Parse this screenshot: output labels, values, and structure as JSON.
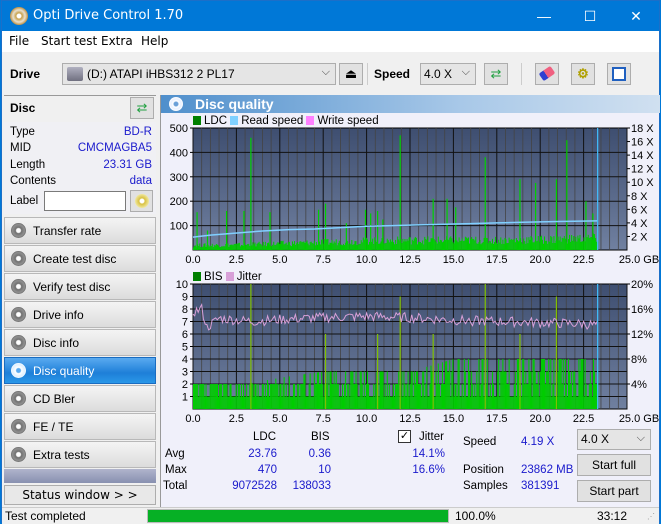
{
  "window": {
    "title": "Opti Drive Control 1.70",
    "minimize": "—",
    "maximize": "☐",
    "close": "✕"
  },
  "menu": [
    "File",
    "Start test",
    "Extra",
    "Help"
  ],
  "toolbar": {
    "drive_label": "Drive",
    "drive_value": "(D:)  ATAPI iHBS312  2 PL17",
    "speed_label": "Speed",
    "speed_value": "4.0 X"
  },
  "disc": {
    "title": "Disc",
    "rows": [
      {
        "key": "Type",
        "value": "BD-R"
      },
      {
        "key": "MID",
        "value": "CMCMAGBA5"
      },
      {
        "key": "Length",
        "value": "23.31 GB"
      },
      {
        "key": "Contents",
        "value": "data"
      }
    ],
    "label_key": "Label",
    "label_value": ""
  },
  "nav": [
    {
      "label": "Transfer rate",
      "active": false
    },
    {
      "label": "Create test disc",
      "active": false
    },
    {
      "label": "Verify test disc",
      "active": false
    },
    {
      "label": "Drive info",
      "active": false
    },
    {
      "label": "Disc info",
      "active": false
    },
    {
      "label": "Disc quality",
      "active": true
    },
    {
      "label": "CD Bler",
      "active": false
    },
    {
      "label": "FE / TE",
      "active": false
    },
    {
      "label": "Extra tests",
      "active": false
    }
  ],
  "status_window_label": "Status window > >",
  "panel_title": "Disc quality",
  "colors": {
    "ldc": "#008000",
    "read_speed": "#80d0ff",
    "write_speed": "#ff80ff",
    "bis": "#008000",
    "jitter": "#d8a0d8",
    "bar_fill": "#00cc00",
    "plot_bg_top": "#3e4e70",
    "plot_bg_bottom": "#7080a0"
  },
  "chart_data": [
    {
      "type": "bar",
      "title": "LDC / Read speed",
      "legend": [
        "LDC",
        "Read speed",
        "Write speed"
      ],
      "x_ticks": [
        "0.0",
        "2.5",
        "5.0",
        "7.5",
        "10.0",
        "12.5",
        "15.0",
        "17.5",
        "20.0",
        "22.5",
        "25.0 GB"
      ],
      "xlim": [
        0,
        25
      ],
      "y_ticks": [
        "100",
        "200",
        "300",
        "400",
        "500"
      ],
      "ylim": [
        0,
        500
      ],
      "y2_ticks": [
        "2 X",
        "4 X",
        "6 X",
        "8 X",
        "10 X",
        "12 X",
        "14 X",
        "16 X",
        "18 X"
      ],
      "y2lim": [
        0,
        18
      ],
      "ldc_baseline": [
        [
          0,
          18
        ],
        [
          2.5,
          20
        ],
        [
          5,
          25
        ],
        [
          7.5,
          30
        ],
        [
          10,
          35
        ],
        [
          12.5,
          38
        ],
        [
          15,
          38
        ],
        [
          17.5,
          38
        ],
        [
          20,
          40
        ],
        [
          22.5,
          45
        ],
        [
          23.3,
          45
        ]
      ],
      "ldc_spikes": [
        [
          0.2,
          155
        ],
        [
          0.8,
          80
        ],
        [
          1.9,
          160
        ],
        [
          2.9,
          160
        ],
        [
          3.3,
          460
        ],
        [
          4.4,
          155
        ],
        [
          7.2,
          165
        ],
        [
          7.6,
          190
        ],
        [
          8.8,
          110
        ],
        [
          9.9,
          165
        ],
        [
          10.2,
          150
        ],
        [
          10.6,
          160
        ],
        [
          10.9,
          125
        ],
        [
          11.9,
          470
        ],
        [
          13.8,
          210
        ],
        [
          14.6,
          210
        ],
        [
          15.1,
          175
        ],
        [
          16.8,
          380
        ],
        [
          18.8,
          290
        ],
        [
          19.7,
          275
        ],
        [
          20.9,
          290
        ],
        [
          21.5,
          450
        ],
        [
          22.6,
          200
        ],
        [
          23.0,
          150
        ]
      ],
      "read_speed": [
        [
          0,
          1.9
        ],
        [
          1.0,
          2.2
        ],
        [
          2.0,
          2.4
        ],
        [
          3.0,
          2.6
        ],
        [
          4.0,
          2.8
        ],
        [
          5.5,
          3.0
        ],
        [
          7.0,
          3.1
        ],
        [
          8.5,
          3.3
        ],
        [
          10.0,
          3.5
        ],
        [
          11.5,
          3.6
        ],
        [
          13.0,
          3.7
        ],
        [
          14.5,
          3.8
        ],
        [
          16.0,
          3.9
        ],
        [
          17.5,
          4.0
        ],
        [
          19.0,
          4.1
        ],
        [
          21.0,
          4.2
        ],
        [
          23.3,
          4.3
        ]
      ],
      "end_marker_gb": 23.31
    },
    {
      "type": "bar",
      "title": "BIS / Jitter",
      "legend": [
        "BIS",
        "Jitter"
      ],
      "x_ticks": [
        "0.0",
        "2.5",
        "5.0",
        "7.5",
        "10.0",
        "12.5",
        "15.0",
        "17.5",
        "20.0",
        "22.5",
        "25.0 GB"
      ],
      "xlim": [
        0,
        25
      ],
      "y_ticks": [
        "1",
        "2",
        "3",
        "4",
        "5",
        "6",
        "7",
        "8",
        "9",
        "10"
      ],
      "ylim": [
        0,
        10
      ],
      "y2_ticks": [
        "4%",
        "8%",
        "12%",
        "16%",
        "20%"
      ],
      "y2lim": [
        0,
        20
      ],
      "bis_level_gb": [
        [
          0,
          2
        ],
        [
          3,
          2
        ],
        [
          5,
          2.5
        ],
        [
          7.5,
          3
        ],
        [
          10,
          3
        ],
        [
          12.5,
          3
        ],
        [
          15,
          4
        ],
        [
          17.5,
          4
        ],
        [
          20,
          4
        ],
        [
          22.5,
          4
        ],
        [
          23.3,
          4
        ]
      ],
      "bis_spikes": [
        [
          3.3,
          10
        ],
        [
          7.6,
          6
        ],
        [
          10.6,
          6
        ],
        [
          11.9,
          9
        ],
        [
          13.8,
          6
        ],
        [
          16.8,
          10
        ],
        [
          18.8,
          6
        ],
        [
          20.9,
          9
        ]
      ],
      "jitter_pct": [
        [
          0,
          15.5
        ],
        [
          0.5,
          16.0
        ],
        [
          0.8,
          13.0
        ],
        [
          1.5,
          14.5
        ],
        [
          2.5,
          14.2
        ],
        [
          3.5,
          14.0
        ],
        [
          5,
          14.3
        ],
        [
          7.5,
          14.6
        ],
        [
          10,
          14.8
        ],
        [
          12.5,
          14.6
        ],
        [
          15,
          14.2
        ],
        [
          17.5,
          14.0
        ],
        [
          20,
          13.8
        ],
        [
          22.5,
          13.6
        ],
        [
          23.3,
          13.4
        ]
      ],
      "end_marker_gb": 23.31
    }
  ],
  "stats": {
    "col_ldc": "LDC",
    "col_bis": "BIS",
    "jitter_label": "Jitter",
    "jitter_checked": true,
    "rows": [
      {
        "label": "Avg",
        "ldc": "23.76",
        "bis": "0.36",
        "jitter": "14.1%"
      },
      {
        "label": "Max",
        "ldc": "470",
        "bis": "10",
        "jitter": "16.6%"
      },
      {
        "label": "Total",
        "ldc": "9072528",
        "bis": "138033",
        "jitter": ""
      }
    ],
    "speed_label": "Speed",
    "speed_value": "4.19 X",
    "position_label": "Position",
    "position_value": "23862 MB",
    "samples_label": "Samples",
    "samples_value": "381391",
    "speed_select": "4.0 X",
    "start_full": "Start full",
    "start_part": "Start part"
  },
  "statusbar": {
    "text": "Test completed",
    "progress": 1.0,
    "progress_text": "100.0%",
    "time": "33:12"
  }
}
